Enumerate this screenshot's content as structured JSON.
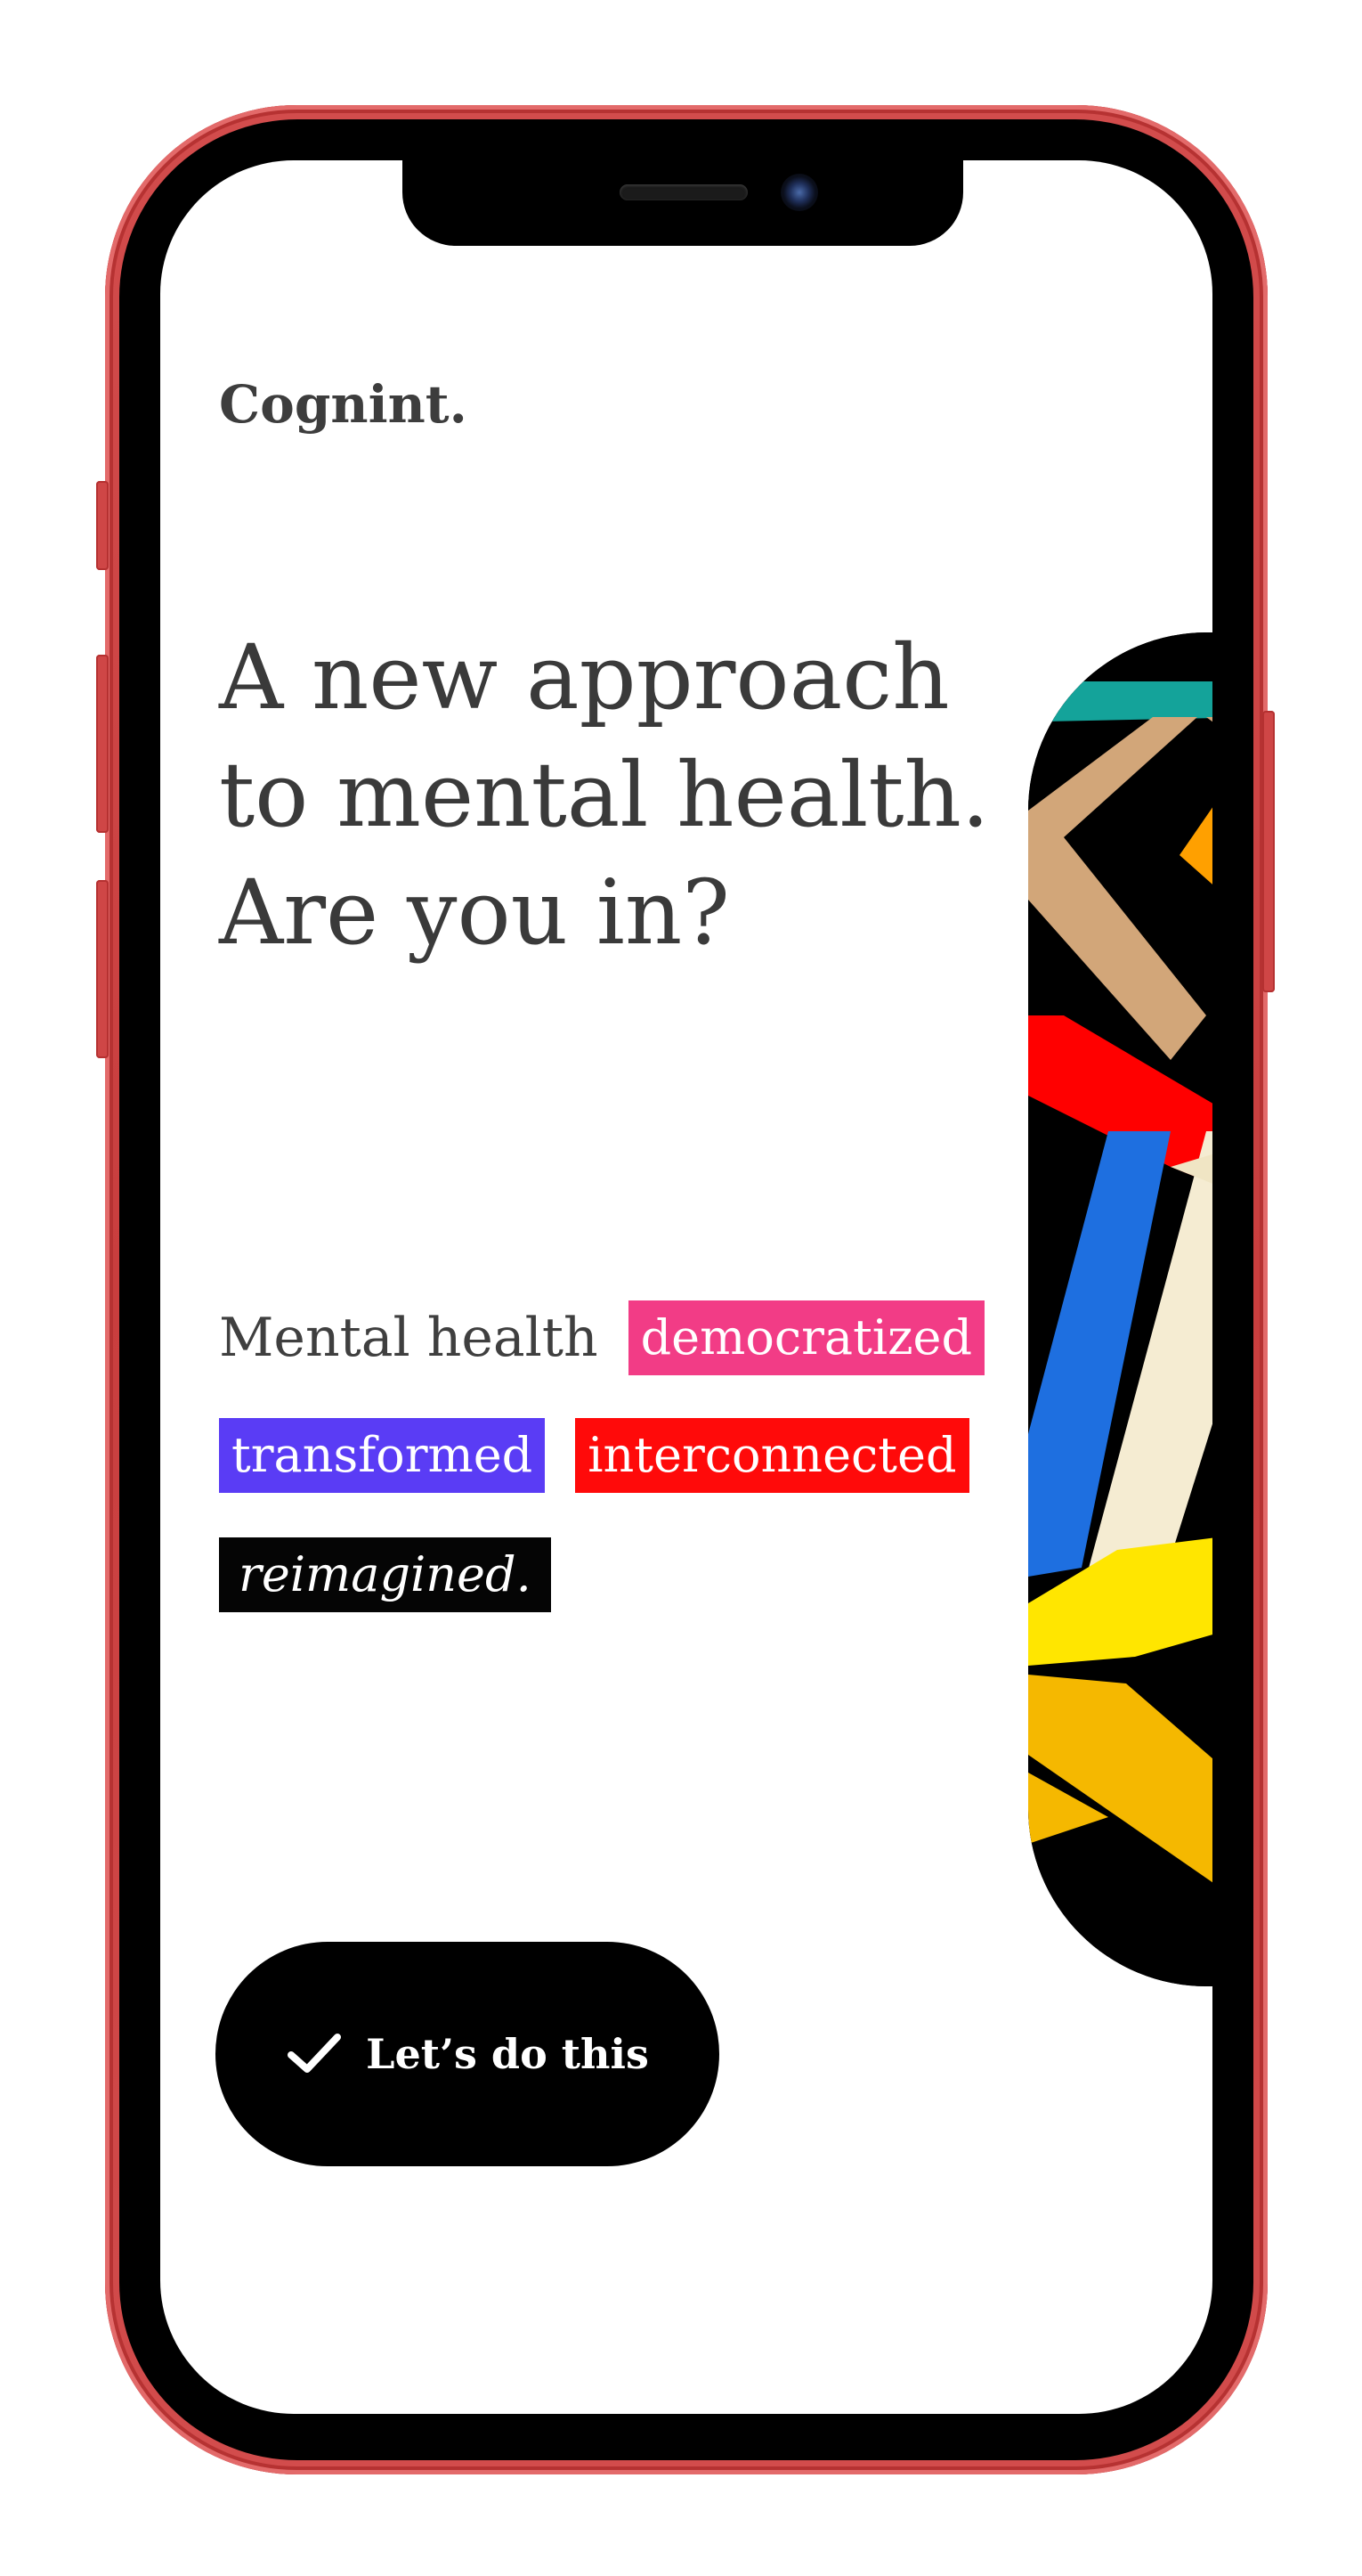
{
  "app": {
    "brand": "Cognint."
  },
  "hero": {
    "headline_lines": [
      "A new approach",
      "to mental health.",
      "Are you in?"
    ]
  },
  "tagline": {
    "lead": "Mental health",
    "tags": [
      {
        "label": "democratized",
        "color": "#f23c86"
      },
      {
        "label": "transformed",
        "color": "#5a3cf5"
      },
      {
        "label": "interconnected",
        "color": "#ff0a0a"
      },
      {
        "label": "reimagined.",
        "color": "#050505"
      }
    ]
  },
  "cta": {
    "label": "Let’s do this",
    "icon": "checkmark-icon"
  },
  "device": {
    "frame_color": "#d24c4c",
    "model": "iphone-frame"
  },
  "artwork": {
    "palette": [
      "#000000",
      "#d2a679",
      "#ff0000",
      "#1e6fe0",
      "#f5ecd2",
      "#ffe600",
      "#f5b800",
      "#14a39a",
      "#ffa000"
    ]
  }
}
